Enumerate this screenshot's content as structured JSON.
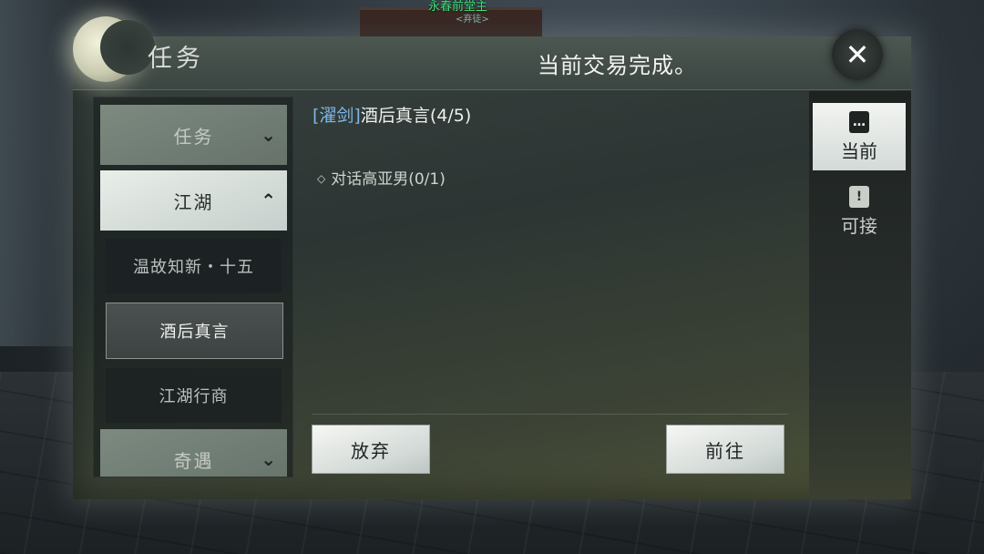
{
  "background": {
    "npc_name": "永春前堂主",
    "npc_subtitle": "<弃徒>"
  },
  "header": {
    "title": "任务",
    "notice": "当前交易完成。",
    "close_icon": "close-icon"
  },
  "sidebar": {
    "categories": [
      {
        "label": "任务",
        "state": "collapsed",
        "chevron": "chevron-down-icon"
      },
      {
        "label": "江湖",
        "state": "expanded",
        "chevron": "chevron-up-icon"
      },
      {
        "label": "奇遇",
        "state": "collapsed",
        "chevron": "chevron-down-icon"
      }
    ],
    "quests": [
      {
        "label": "温故知新・十五",
        "selected": false
      },
      {
        "label": "酒后真言",
        "selected": true
      },
      {
        "label": "江湖行商",
        "selected": false
      }
    ]
  },
  "detail": {
    "tag": "[濯剑]",
    "quest_name": "酒后真言(4/5)",
    "objectives": [
      {
        "label": "对话高亚男(0/1)"
      }
    ]
  },
  "actions": {
    "abandon_label": "放弃",
    "goto_label": "前往"
  },
  "tabs": [
    {
      "label": "当前",
      "icon": "chat-scroll-icon",
      "active": true
    },
    {
      "label": "可接",
      "icon": "exclamation-scroll-icon",
      "active": false
    }
  ],
  "colors": {
    "tag": "#7fb6e6",
    "npc_name": "#3fe07a"
  }
}
